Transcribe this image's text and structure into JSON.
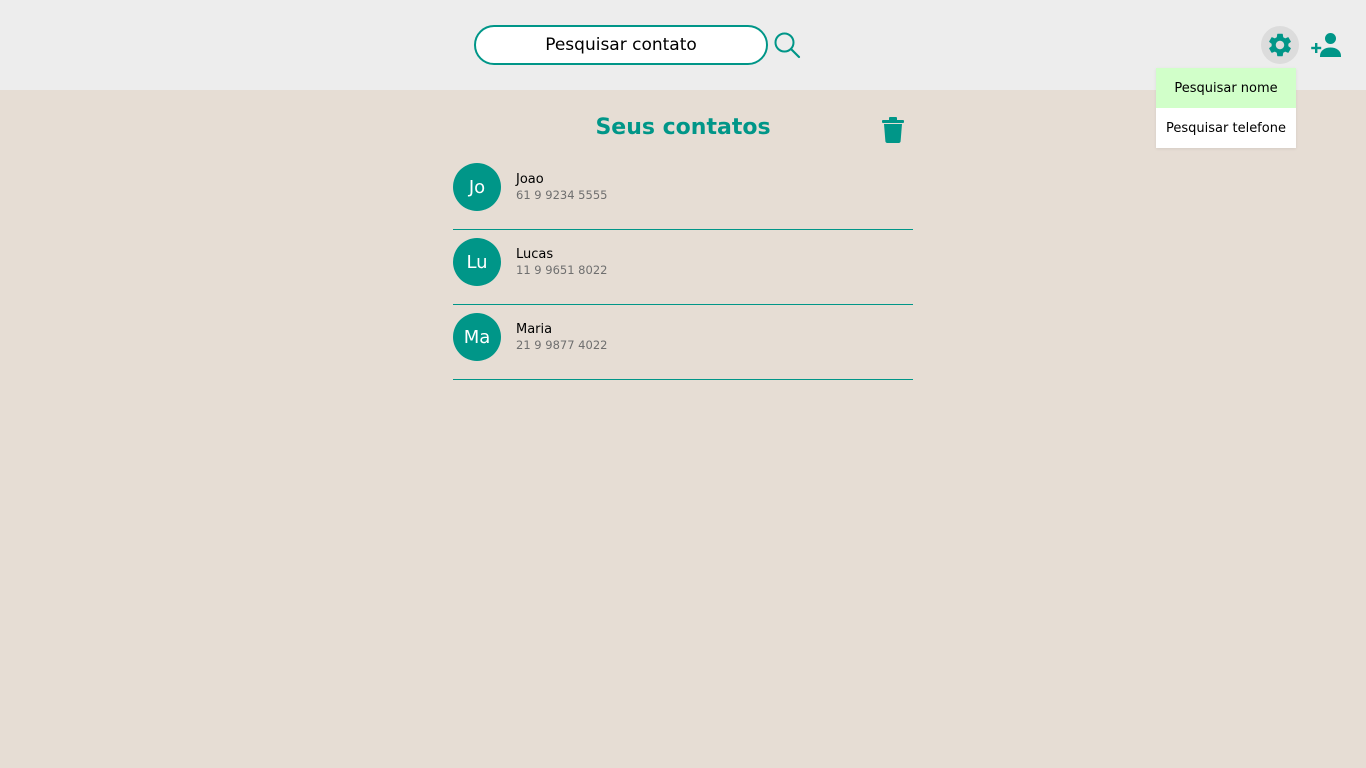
{
  "header": {
    "search": {
      "value": "",
      "placeholder": "Pesquisar contato"
    },
    "icons": {
      "search": "search-icon",
      "settings": "gear-icon",
      "add_contact": "person-add-icon"
    }
  },
  "dropdown": {
    "items": [
      {
        "label": "Pesquisar nome",
        "active": true
      },
      {
        "label": "Pesquisar telefone",
        "active": false
      }
    ]
  },
  "main": {
    "title": "Seus contatos",
    "delete_icon": "trash-icon",
    "contacts": [
      {
        "initials": "Jo",
        "name": "Joao",
        "phone": "61 9 9234 5555"
      },
      {
        "initials": "Lu",
        "name": "Lucas",
        "phone": "11 9 9651 8022"
      },
      {
        "initials": "Ma",
        "name": "Maria",
        "phone": "21 9 9877 4022"
      }
    ]
  },
  "colors": {
    "accent": "#009688",
    "background": "#e6ddd4",
    "header": "#ededed",
    "dropdown_active": "#d1ffc9"
  }
}
